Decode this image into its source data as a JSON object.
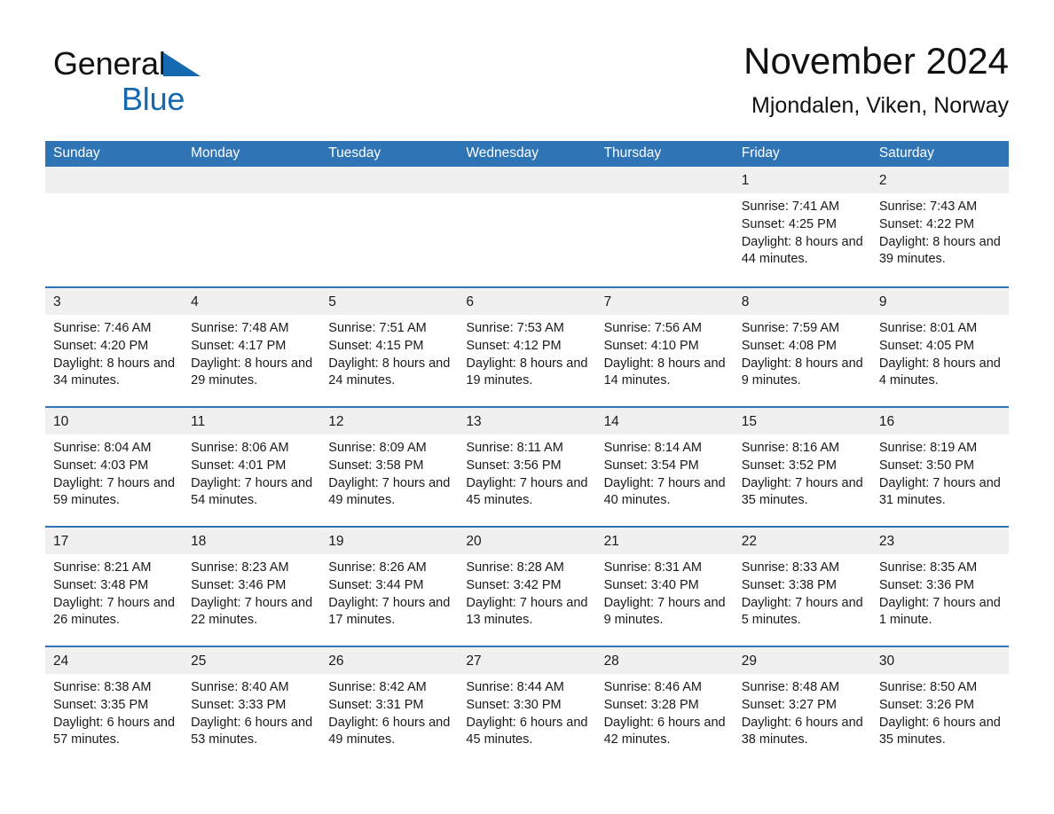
{
  "brand": {
    "name_part1": "General",
    "name_part2": "Blue",
    "logo_icon": "triangle-flag-icon"
  },
  "header": {
    "month_title": "November 2024",
    "location": "Mjondalen, Viken, Norway"
  },
  "colors": {
    "header_blue": "#2f74b5",
    "brand_blue": "#1569b0",
    "daynum_band": "#f0f0f0",
    "text": "#1a1a1a"
  },
  "weekday_headers": [
    "Sunday",
    "Monday",
    "Tuesday",
    "Wednesday",
    "Thursday",
    "Friday",
    "Saturday"
  ],
  "weeks": [
    [
      {
        "day": "",
        "empty": true
      },
      {
        "day": "",
        "empty": true
      },
      {
        "day": "",
        "empty": true
      },
      {
        "day": "",
        "empty": true
      },
      {
        "day": "",
        "empty": true
      },
      {
        "day": "1",
        "sunrise": "Sunrise: 7:41 AM",
        "sunset": "Sunset: 4:25 PM",
        "daylight": "Daylight: 8 hours and 44 minutes."
      },
      {
        "day": "2",
        "sunrise": "Sunrise: 7:43 AM",
        "sunset": "Sunset: 4:22 PM",
        "daylight": "Daylight: 8 hours and 39 minutes."
      }
    ],
    [
      {
        "day": "3",
        "sunrise": "Sunrise: 7:46 AM",
        "sunset": "Sunset: 4:20 PM",
        "daylight": "Daylight: 8 hours and 34 minutes."
      },
      {
        "day": "4",
        "sunrise": "Sunrise: 7:48 AM",
        "sunset": "Sunset: 4:17 PM",
        "daylight": "Daylight: 8 hours and 29 minutes."
      },
      {
        "day": "5",
        "sunrise": "Sunrise: 7:51 AM",
        "sunset": "Sunset: 4:15 PM",
        "daylight": "Daylight: 8 hours and 24 minutes."
      },
      {
        "day": "6",
        "sunrise": "Sunrise: 7:53 AM",
        "sunset": "Sunset: 4:12 PM",
        "daylight": "Daylight: 8 hours and 19 minutes."
      },
      {
        "day": "7",
        "sunrise": "Sunrise: 7:56 AM",
        "sunset": "Sunset: 4:10 PM",
        "daylight": "Daylight: 8 hours and 14 minutes."
      },
      {
        "day": "8",
        "sunrise": "Sunrise: 7:59 AM",
        "sunset": "Sunset: 4:08 PM",
        "daylight": "Daylight: 8 hours and 9 minutes."
      },
      {
        "day": "9",
        "sunrise": "Sunrise: 8:01 AM",
        "sunset": "Sunset: 4:05 PM",
        "daylight": "Daylight: 8 hours and 4 minutes."
      }
    ],
    [
      {
        "day": "10",
        "sunrise": "Sunrise: 8:04 AM",
        "sunset": "Sunset: 4:03 PM",
        "daylight": "Daylight: 7 hours and 59 minutes."
      },
      {
        "day": "11",
        "sunrise": "Sunrise: 8:06 AM",
        "sunset": "Sunset: 4:01 PM",
        "daylight": "Daylight: 7 hours and 54 minutes."
      },
      {
        "day": "12",
        "sunrise": "Sunrise: 8:09 AM",
        "sunset": "Sunset: 3:58 PM",
        "daylight": "Daylight: 7 hours and 49 minutes."
      },
      {
        "day": "13",
        "sunrise": "Sunrise: 8:11 AM",
        "sunset": "Sunset: 3:56 PM",
        "daylight": "Daylight: 7 hours and 45 minutes."
      },
      {
        "day": "14",
        "sunrise": "Sunrise: 8:14 AM",
        "sunset": "Sunset: 3:54 PM",
        "daylight": "Daylight: 7 hours and 40 minutes."
      },
      {
        "day": "15",
        "sunrise": "Sunrise: 8:16 AM",
        "sunset": "Sunset: 3:52 PM",
        "daylight": "Daylight: 7 hours and 35 minutes."
      },
      {
        "day": "16",
        "sunrise": "Sunrise: 8:19 AM",
        "sunset": "Sunset: 3:50 PM",
        "daylight": "Daylight: 7 hours and 31 minutes."
      }
    ],
    [
      {
        "day": "17",
        "sunrise": "Sunrise: 8:21 AM",
        "sunset": "Sunset: 3:48 PM",
        "daylight": "Daylight: 7 hours and 26 minutes."
      },
      {
        "day": "18",
        "sunrise": "Sunrise: 8:23 AM",
        "sunset": "Sunset: 3:46 PM",
        "daylight": "Daylight: 7 hours and 22 minutes."
      },
      {
        "day": "19",
        "sunrise": "Sunrise: 8:26 AM",
        "sunset": "Sunset: 3:44 PM",
        "daylight": "Daylight: 7 hours and 17 minutes."
      },
      {
        "day": "20",
        "sunrise": "Sunrise: 8:28 AM",
        "sunset": "Sunset: 3:42 PM",
        "daylight": "Daylight: 7 hours and 13 minutes."
      },
      {
        "day": "21",
        "sunrise": "Sunrise: 8:31 AM",
        "sunset": "Sunset: 3:40 PM",
        "daylight": "Daylight: 7 hours and 9 minutes."
      },
      {
        "day": "22",
        "sunrise": "Sunrise: 8:33 AM",
        "sunset": "Sunset: 3:38 PM",
        "daylight": "Daylight: 7 hours and 5 minutes."
      },
      {
        "day": "23",
        "sunrise": "Sunrise: 8:35 AM",
        "sunset": "Sunset: 3:36 PM",
        "daylight": "Daylight: 7 hours and 1 minute."
      }
    ],
    [
      {
        "day": "24",
        "sunrise": "Sunrise: 8:38 AM",
        "sunset": "Sunset: 3:35 PM",
        "daylight": "Daylight: 6 hours and 57 minutes."
      },
      {
        "day": "25",
        "sunrise": "Sunrise: 8:40 AM",
        "sunset": "Sunset: 3:33 PM",
        "daylight": "Daylight: 6 hours and 53 minutes."
      },
      {
        "day": "26",
        "sunrise": "Sunrise: 8:42 AM",
        "sunset": "Sunset: 3:31 PM",
        "daylight": "Daylight: 6 hours and 49 minutes."
      },
      {
        "day": "27",
        "sunrise": "Sunrise: 8:44 AM",
        "sunset": "Sunset: 3:30 PM",
        "daylight": "Daylight: 6 hours and 45 minutes."
      },
      {
        "day": "28",
        "sunrise": "Sunrise: 8:46 AM",
        "sunset": "Sunset: 3:28 PM",
        "daylight": "Daylight: 6 hours and 42 minutes."
      },
      {
        "day": "29",
        "sunrise": "Sunrise: 8:48 AM",
        "sunset": "Sunset: 3:27 PM",
        "daylight": "Daylight: 6 hours and 38 minutes."
      },
      {
        "day": "30",
        "sunrise": "Sunrise: 8:50 AM",
        "sunset": "Sunset: 3:26 PM",
        "daylight": "Daylight: 6 hours and 35 minutes."
      }
    ]
  ]
}
